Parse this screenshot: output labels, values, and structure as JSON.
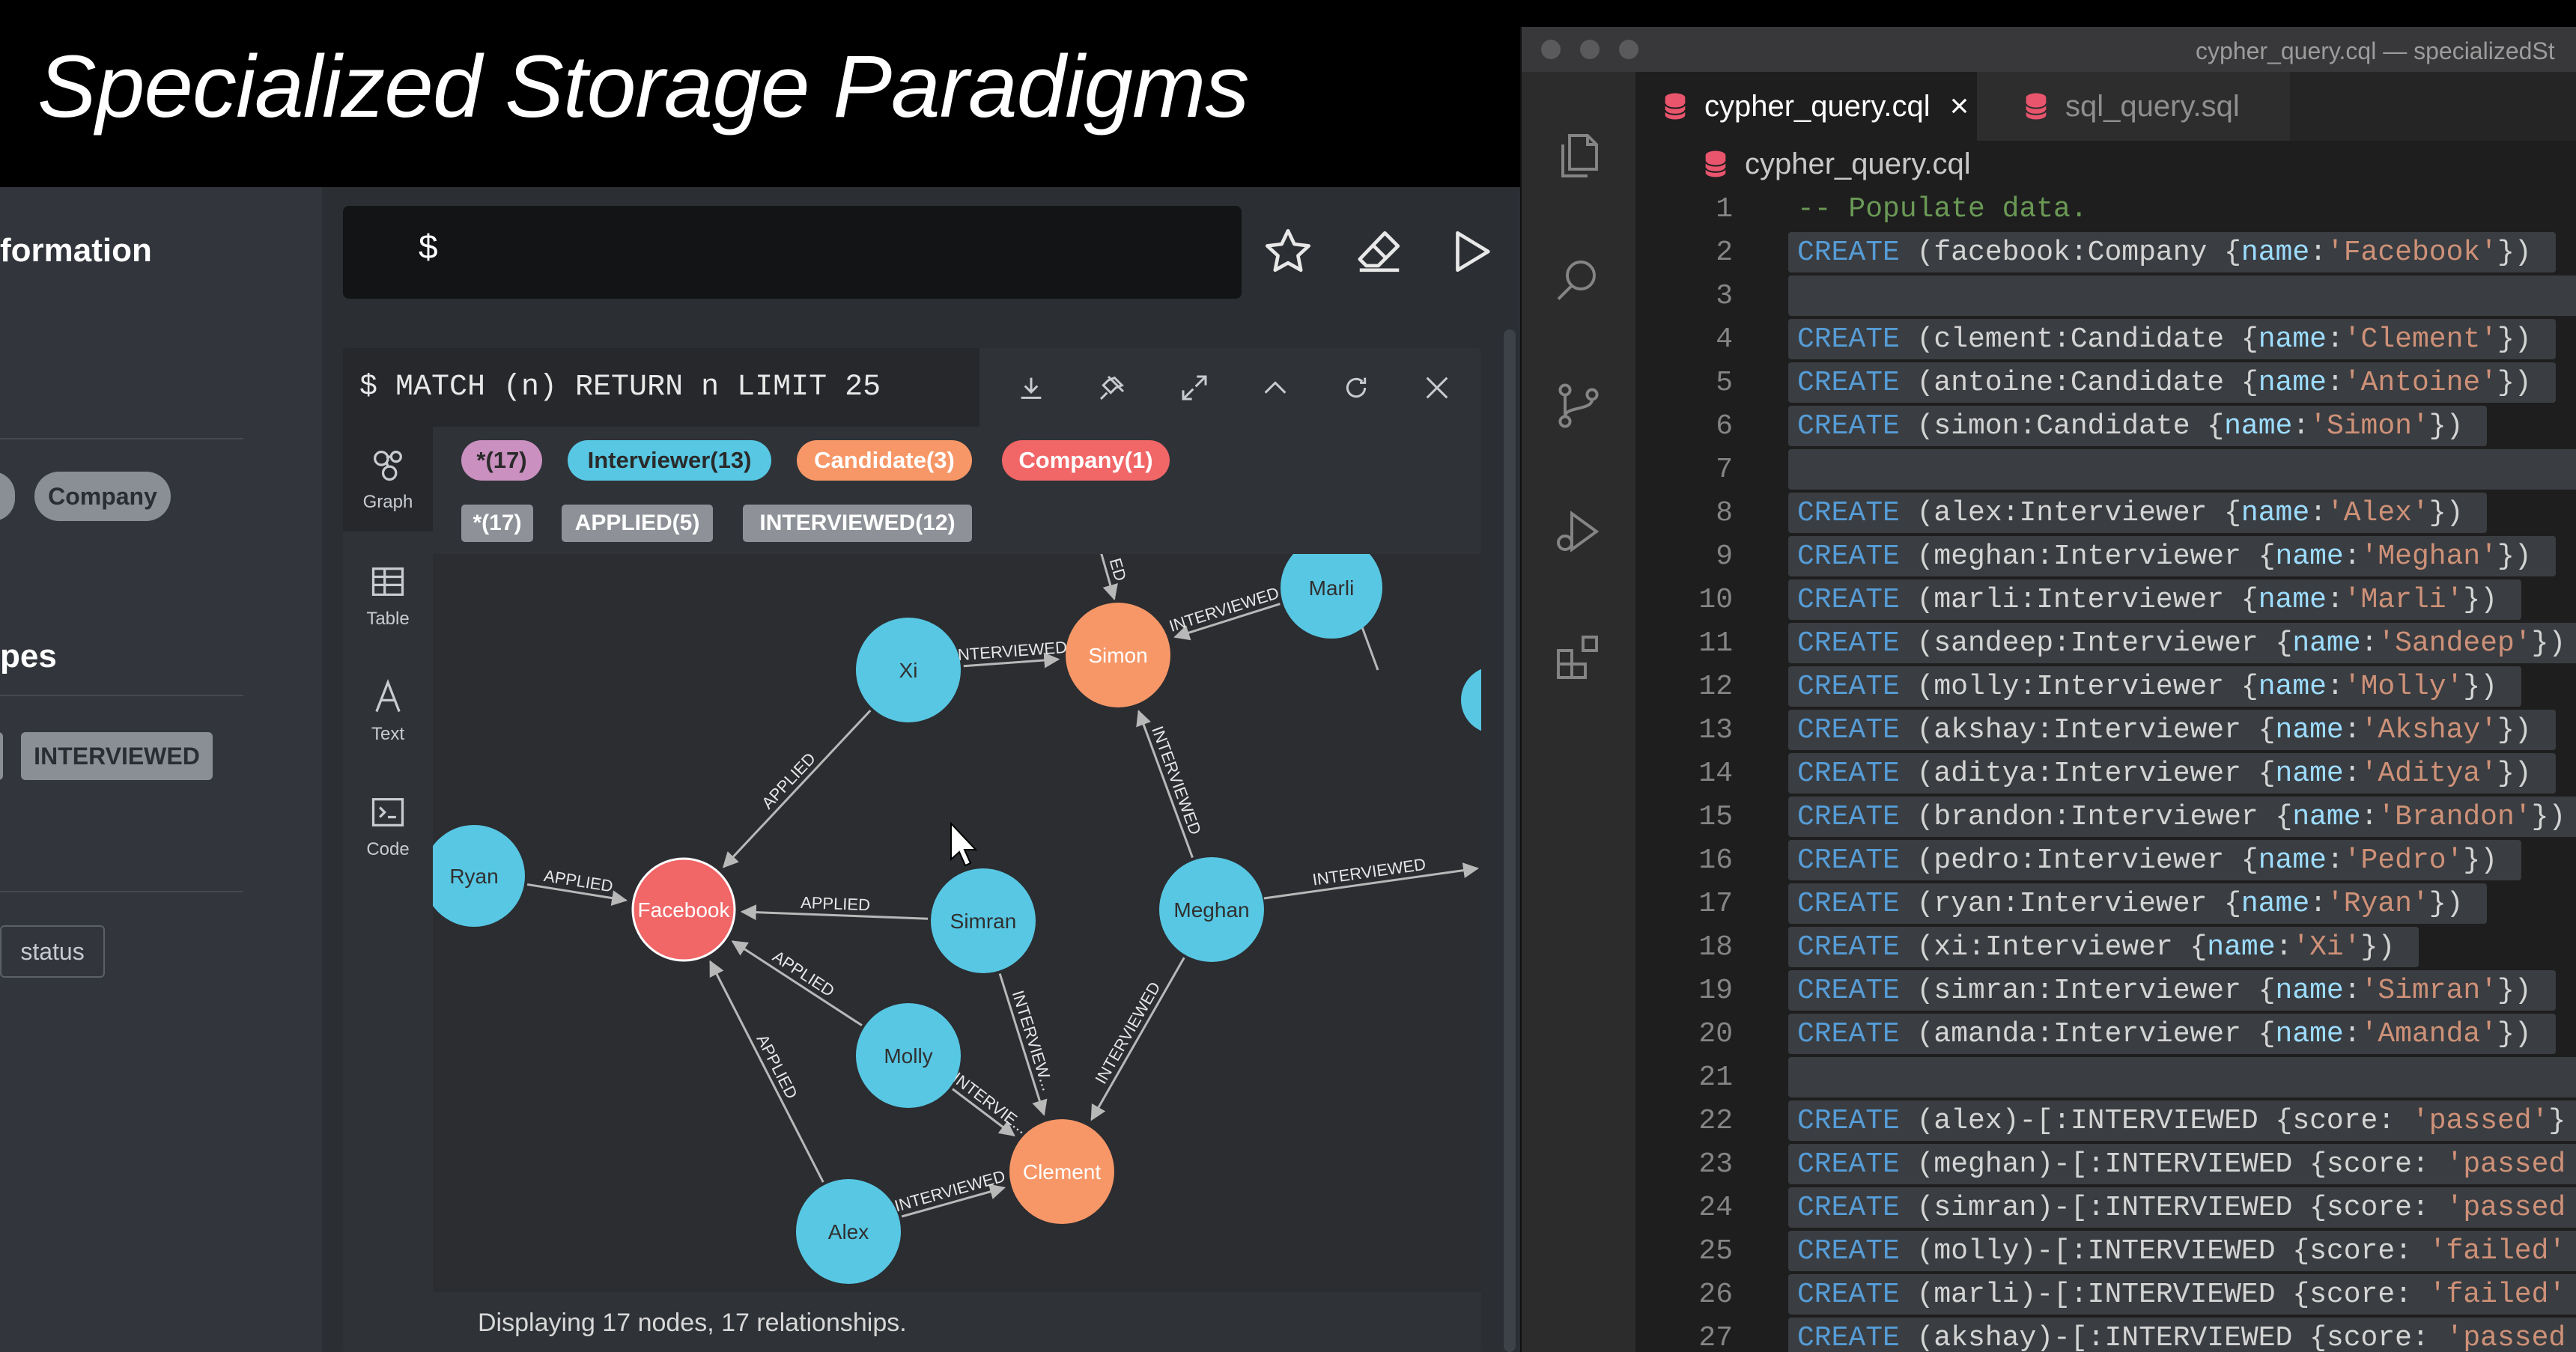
{
  "slide": {
    "title": "Specialized Storage Paradigms"
  },
  "left_sidebar": {
    "heading_information": "formation",
    "heading_types": "pes",
    "node_label_pill": "Company",
    "rel_type_tag": "INTERVIEWED",
    "property_key": "status"
  },
  "editor": {
    "prompt": "$"
  },
  "result_frame": {
    "query": "$ MATCH (n) RETURN n LIMIT 25",
    "rail": {
      "graph": "Graph",
      "table": "Table",
      "text": "Text",
      "code": "Code"
    },
    "node_labels": [
      {
        "label": "*(17)",
        "color": "#c990c0",
        "text_color": "#2a2a2a"
      },
      {
        "label": "Interviewer(13)",
        "color": "#57c7e3",
        "text_color": "#2a2a2a"
      },
      {
        "label": "Candidate(3)",
        "color": "#f79767",
        "text_color": "#ffffff"
      },
      {
        "label": "Company(1)",
        "color": "#f16667",
        "text_color": "#ffffff"
      }
    ],
    "rel_types": [
      {
        "label": "*(17)"
      },
      {
        "label": "APPLIED(5)"
      },
      {
        "label": "INTERVIEWED(12)"
      }
    ],
    "status": "Displaying 17 nodes, 17 relationships."
  },
  "graph": {
    "colors": {
      "interviewer": "#57c7e3",
      "candidate": "#f79767",
      "company": "#f16667",
      "edge": "#b8b8b8"
    },
    "nodes": {
      "simon": {
        "name": "Simon",
        "kind": "candidate"
      },
      "marli": {
        "name": "Marli",
        "kind": "interviewer"
      },
      "xi": {
        "name": "Xi",
        "kind": "interviewer"
      },
      "ryan": {
        "name": "Ryan",
        "kind": "interviewer"
      },
      "facebook": {
        "name": "Facebook",
        "kind": "company"
      },
      "simran": {
        "name": "Simran",
        "kind": "interviewer"
      },
      "meghan": {
        "name": "Meghan",
        "kind": "interviewer"
      },
      "molly": {
        "name": "Molly",
        "kind": "interviewer"
      },
      "clement": {
        "name": "Clement",
        "kind": "candidate"
      },
      "alex": {
        "name": "Alex",
        "kind": "interviewer"
      }
    },
    "edges": {
      "xi_simon": "INTERVIEWED",
      "marli_simon": "INTERVIEWED",
      "xi_facebook": "APPLIED",
      "meghan_simon": "INTERVIEWED",
      "ryan_facebook": "APPLIED",
      "simran_facebook": "APPLIED",
      "meghan_out": "INTERVIEWED",
      "simran_clement": "INTERVIEW...",
      "molly_facebook": "APPLIED",
      "alex_facebook": "APPLIED",
      "molly_clement": "INTERVIE...",
      "meghan_clement": "INTERVIEWED",
      "alex_clement": "INTERVIEWED",
      "top_simon": "ED"
    }
  },
  "vscode": {
    "window_title": "cypher_query.cql — specializedSt",
    "tabs": [
      {
        "name": "cypher_query.cql",
        "close": "×"
      },
      {
        "name": "sql_query.sql"
      }
    ],
    "breadcrumb": "cypher_query.cql",
    "lines": [
      {
        "n": "1",
        "c": "-- Populate data."
      },
      {
        "n": "2",
        "c": "CREATE (facebook:Company {name:'Facebook'})"
      },
      {
        "n": "3",
        "c": ""
      },
      {
        "n": "4",
        "c": "CREATE (clement:Candidate {name:'Clement'})"
      },
      {
        "n": "5",
        "c": "CREATE (antoine:Candidate {name:'Antoine'})"
      },
      {
        "n": "6",
        "c": "CREATE (simon:Candidate {name:'Simon'})"
      },
      {
        "n": "7",
        "c": ""
      },
      {
        "n": "8",
        "c": "CREATE (alex:Interviewer {name:'Alex'})"
      },
      {
        "n": "9",
        "c": "CREATE (meghan:Interviewer {name:'Meghan'})"
      },
      {
        "n": "10",
        "c": "CREATE (marli:Interviewer {name:'Marli'})"
      },
      {
        "n": "11",
        "c": "CREATE (sandeep:Interviewer {name:'Sandeep'})"
      },
      {
        "n": "12",
        "c": "CREATE (molly:Interviewer {name:'Molly'})"
      },
      {
        "n": "13",
        "c": "CREATE (akshay:Interviewer {name:'Akshay'})"
      },
      {
        "n": "14",
        "c": "CREATE (aditya:Interviewer {name:'Aditya'})"
      },
      {
        "n": "15",
        "c": "CREATE (brandon:Interviewer {name:'Brandon'})"
      },
      {
        "n": "16",
        "c": "CREATE (pedro:Interviewer {name:'Pedro'})"
      },
      {
        "n": "17",
        "c": "CREATE (ryan:Interviewer {name:'Ryan'})"
      },
      {
        "n": "18",
        "c": "CREATE (xi:Interviewer {name:'Xi'})"
      },
      {
        "n": "19",
        "c": "CREATE (simran:Interviewer {name:'Simran'})"
      },
      {
        "n": "20",
        "c": "CREATE (amanda:Interviewer {name:'Amanda'})"
      },
      {
        "n": "21",
        "c": ""
      },
      {
        "n": "22",
        "c": "CREATE (alex)-[:INTERVIEWED {score: 'passed'}"
      },
      {
        "n": "23",
        "c": "CREATE (meghan)-[:INTERVIEWED {score: 'passed"
      },
      {
        "n": "24",
        "c": "CREATE (simran)-[:INTERVIEWED {score: 'passed"
      },
      {
        "n": "25",
        "c": "CREATE (molly)-[:INTERVIEWED {score: 'failed'"
      },
      {
        "n": "26",
        "c": "CREATE (marli)-[:INTERVIEWED {score: 'failed'"
      },
      {
        "n": "27",
        "c": "CREATE (akshay)-[:INTERVIEWED {score: 'passed"
      }
    ]
  }
}
